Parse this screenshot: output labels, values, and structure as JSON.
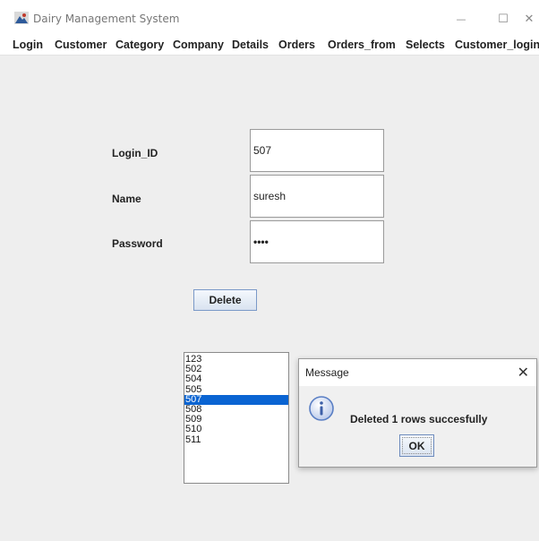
{
  "window": {
    "title": "Dairy Management System",
    "minimize_glyph": "—",
    "maximize_glyph": "☐",
    "close_glyph": "✕"
  },
  "menu": [
    "Login",
    "Customer",
    "Category",
    "Company",
    "Details",
    "Orders",
    "Orders_from",
    "Selects",
    "Customer_login"
  ],
  "form": {
    "login_id_label": "Login_ID",
    "login_id_value": "507",
    "name_label": "Name",
    "name_value": "suresh",
    "password_label": "Password",
    "password_value": "••••",
    "delete_button": "Delete"
  },
  "list": {
    "items": [
      "123",
      "502",
      "504",
      "505",
      "507",
      "508",
      "509",
      "510",
      "511"
    ],
    "selected": "507"
  },
  "dialog": {
    "title": "Message",
    "close_glyph": "✕",
    "icon": "info-icon",
    "message": "Deleted 1 rows succesfully",
    "ok_button": "OK"
  },
  "colors": {
    "selection": "#0a64d2",
    "content_bg": "#eeeeee",
    "info_icon": "#5a7fc4"
  }
}
